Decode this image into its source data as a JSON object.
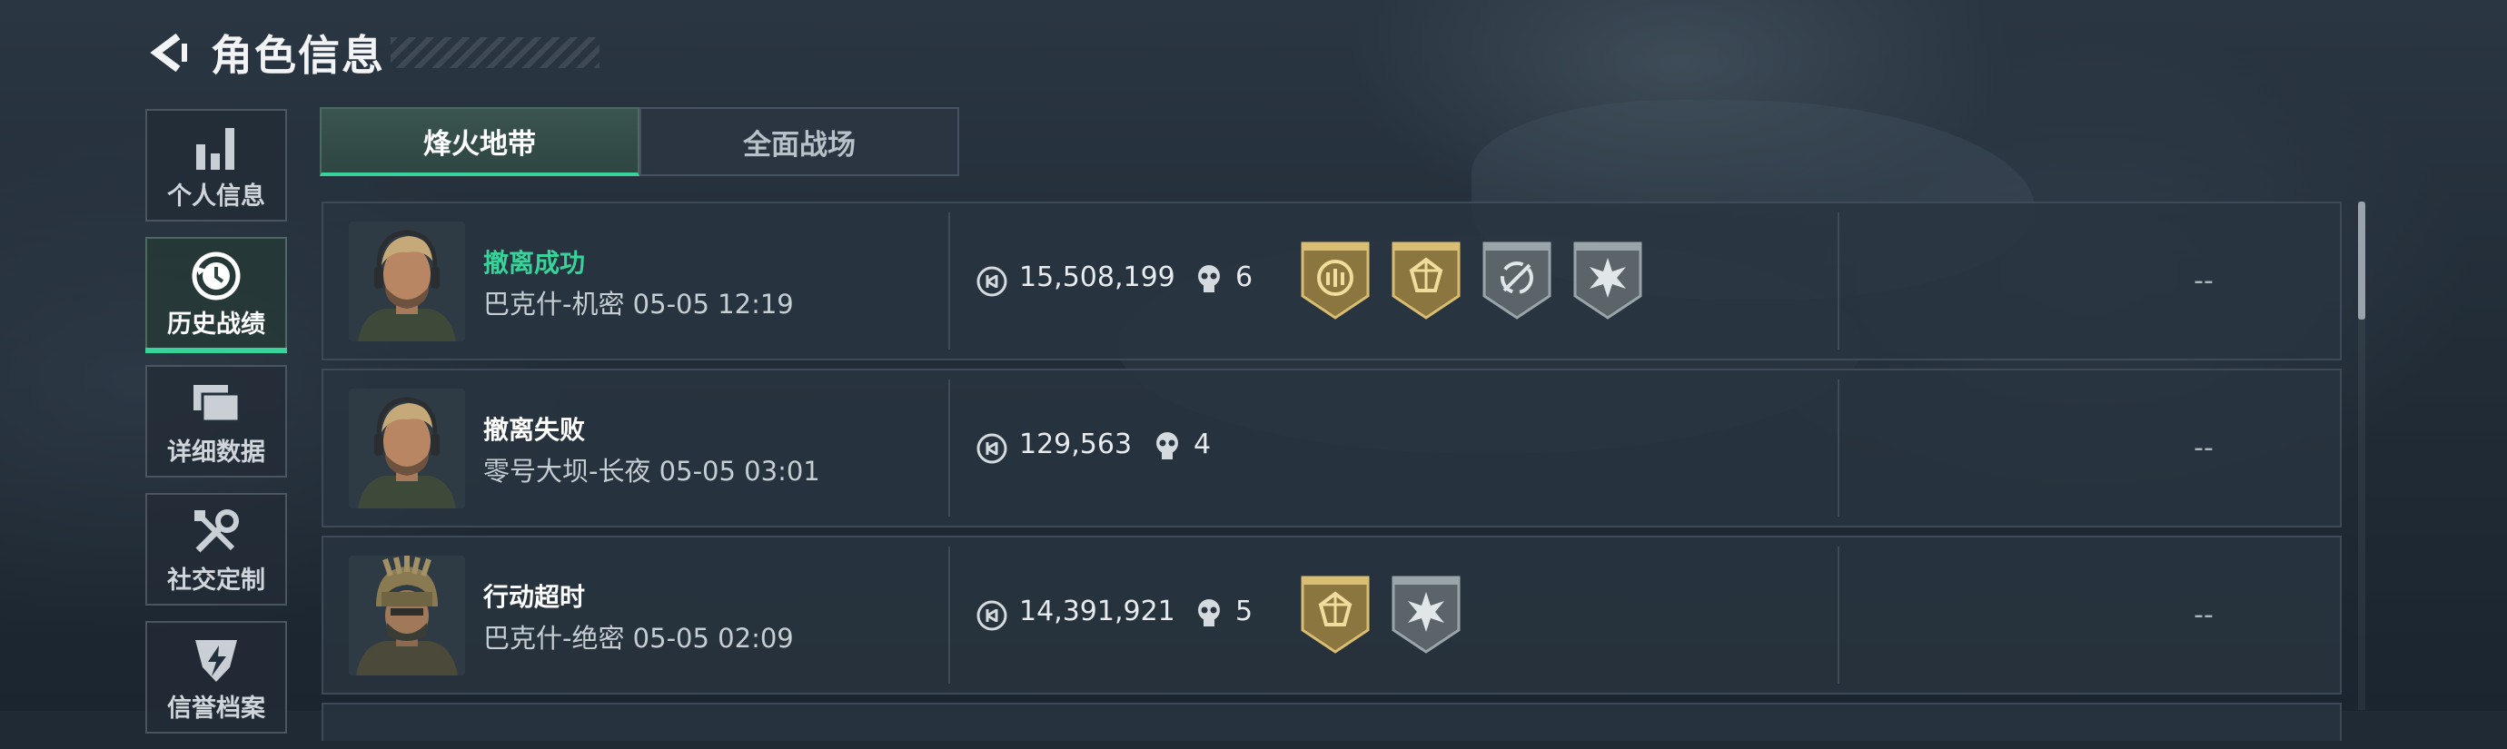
{
  "header": {
    "title": "角色信息",
    "back_icon": "chevron-left-icon"
  },
  "sidebar": {
    "items": [
      {
        "label": "个人信息",
        "icon": "bar-chart-icon",
        "active": false
      },
      {
        "label": "历史战绩",
        "icon": "clock-history-icon",
        "active": true
      },
      {
        "label": "详细数据",
        "icon": "stacked-cards-icon",
        "active": false
      },
      {
        "label": "社交定制",
        "icon": "tools-icon",
        "active": false
      },
      {
        "label": "信誉档案",
        "icon": "shield-lightning-icon",
        "active": false
      }
    ]
  },
  "tabs": [
    {
      "label": "烽火地带",
      "active": true
    },
    {
      "label": "全面战场",
      "active": false
    }
  ],
  "records": [
    {
      "status": "撤离成功",
      "status_type": "success",
      "map_time": "巴克什-机密 05-05 12:19",
      "value": "15,508,199",
      "kills": "6",
      "badges": [
        "gold-emblem-badge",
        "gold-crystal-badge",
        "silver-swirl-badge",
        "silver-burst-badge"
      ],
      "result": "--"
    },
    {
      "status": "撤离失败",
      "status_type": "fail",
      "map_time": "零号大坝-长夜 05-05 03:01",
      "value": "129,563",
      "kills": "4",
      "badges": [],
      "result": "--"
    },
    {
      "status": "行动超时",
      "status_type": "timeout",
      "map_time": "巴克什-绝密 05-05 02:09",
      "value": "14,391,921",
      "kills": "5",
      "badges": [
        "gold-crystal-badge",
        "silver-burst-badge"
      ],
      "result": "--"
    }
  ],
  "colors": {
    "accent": "#37d39a",
    "panel": "#283440",
    "gold": "#b99a54",
    "silver": "#7f8a90"
  }
}
